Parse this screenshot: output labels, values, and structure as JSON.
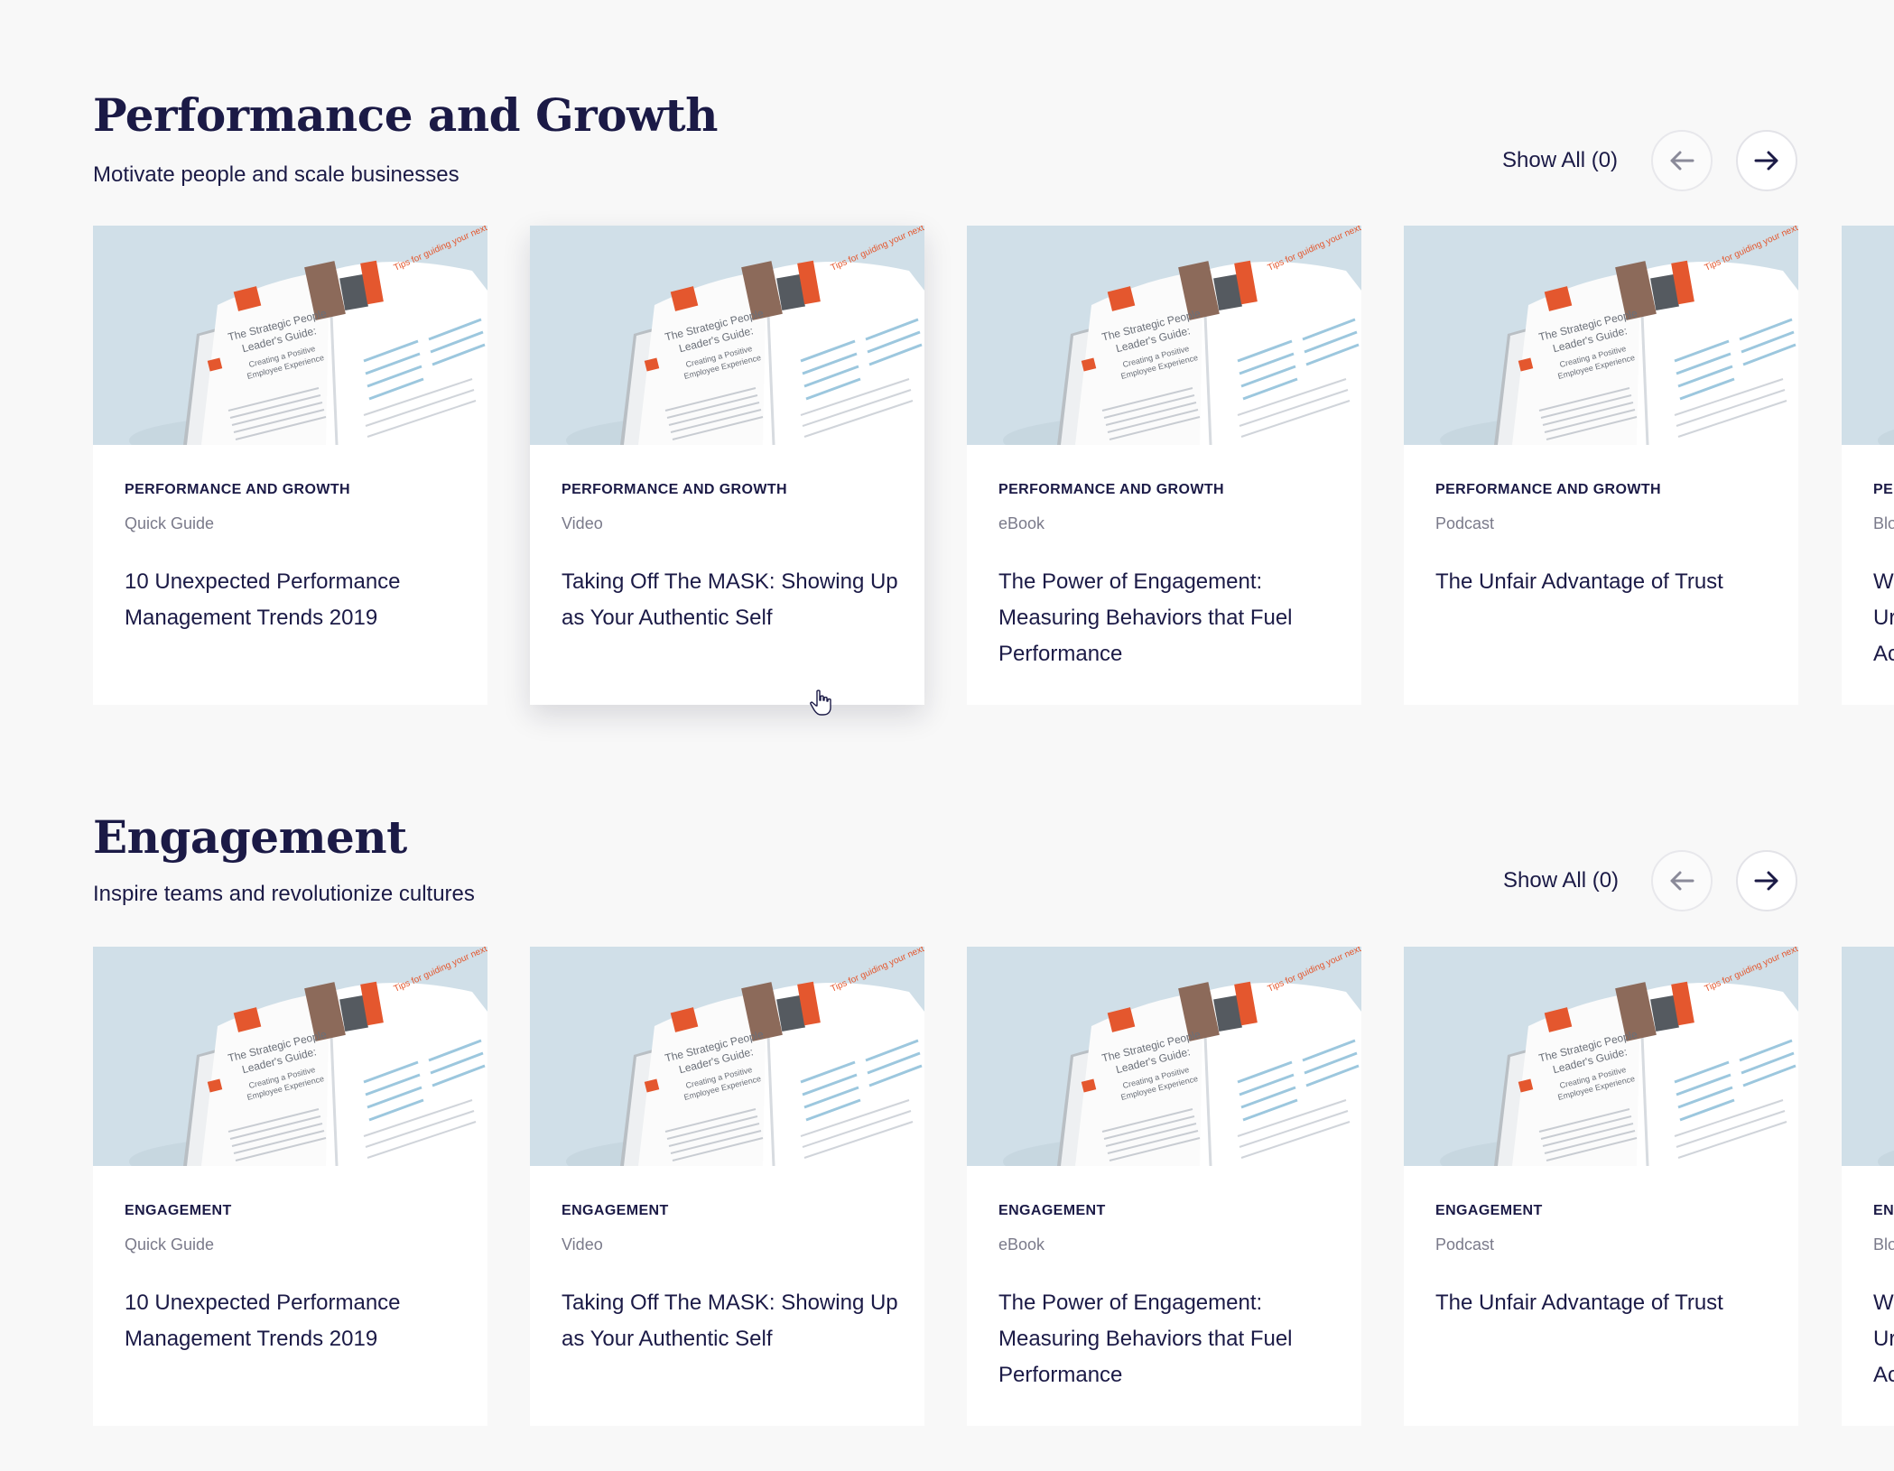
{
  "sections": [
    {
      "title": "Performance and Growth",
      "subtitle": "Motivate people and scale businesses",
      "show_all": "Show All (0)",
      "prev_icon": "arrow-left-icon",
      "next_icon": "arrow-right-icon",
      "cards": [
        {
          "category": "PERFORMANCE AND GROWTH",
          "type": "Quick Guide",
          "title": "10 Unexpected Performance Management Trends 2019"
        },
        {
          "category": "PERFORMANCE AND GROWTH",
          "type": "Video",
          "title": "Taking Off The MASK: Showing Up as Your Authentic Self"
        },
        {
          "category": "PERFORMANCE AND GROWTH",
          "type": "eBook",
          "title": "The Power of Engagement: Measuring Behaviors that Fuel Performance"
        },
        {
          "category": "PERFORMANCE AND GROWTH",
          "type": "Podcast",
          "title": "The Unfair Advantage of Trust"
        },
        {
          "category": "PE",
          "type": "Blo",
          "title": "W Ur Ac"
        }
      ]
    },
    {
      "title": "Engagement",
      "subtitle": "Inspire teams and revolutionize cultures",
      "show_all": "Show All (0)",
      "prev_icon": "arrow-left-icon",
      "next_icon": "arrow-right-icon",
      "cards": [
        {
          "category": "ENGAGEMENT",
          "type": "Quick Guide",
          "title": "10 Unexpected Performance Management Trends 2019"
        },
        {
          "category": "ENGAGEMENT",
          "type": "Video",
          "title": "Taking Off The MASK: Showing Up as Your Authentic Self"
        },
        {
          "category": "ENGAGEMENT",
          "type": "eBook",
          "title": "The Power of Engagement: Measuring Behaviors that Fuel Performance"
        },
        {
          "category": "ENGAGEMENT",
          "type": "Podcast",
          "title": "The Unfair Advantage of Trust"
        },
        {
          "category": "EN",
          "type": "Blo",
          "title": "W Ur Ac"
        }
      ]
    }
  ],
  "thumbnail": {
    "icon": "open-book-guide-image",
    "cover_text": [
      "The Strategic People",
      "Leader's Guide:",
      "Creating a Positive",
      "Employee Experience"
    ],
    "page_text": "Tips for guiding your next"
  },
  "colors": {
    "background": "#f8f8f8",
    "heading": "#1b1a46",
    "muted": "#7a7a8a",
    "thumbnail_bg": "#d0dfe8",
    "accent_orange": "#e4572e"
  },
  "cursor_icon": "hand-pointer-icon"
}
